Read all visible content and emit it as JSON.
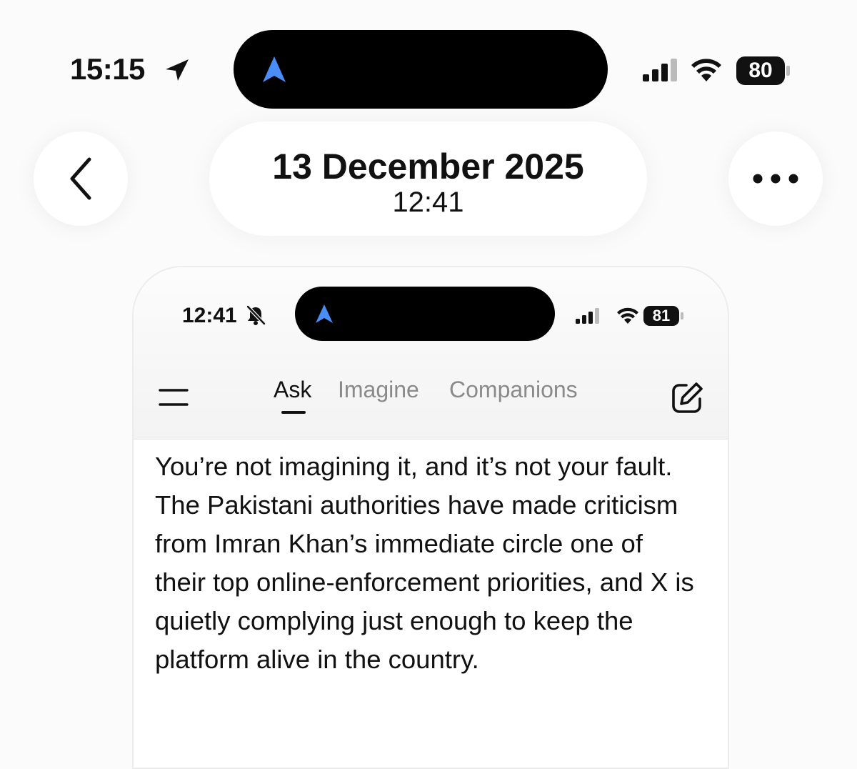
{
  "status_bar": {
    "time": "15:15",
    "battery": "80",
    "icons": [
      "location-arrow-icon",
      "signal-icon",
      "wifi-icon",
      "battery-icon"
    ]
  },
  "header": {
    "date": "13 December 2025",
    "time": "12:41",
    "icons": [
      "chevron-left-icon",
      "more-icon"
    ]
  },
  "screenshot": {
    "status_bar": {
      "time": "12:41",
      "battery": "81",
      "icons": [
        "bell-slash-icon",
        "signal-icon",
        "wifi-icon",
        "battery-icon"
      ]
    },
    "nav": {
      "tabs": [
        "Ask",
        "Imagine",
        "Companions"
      ],
      "active_tab": "Ask",
      "icons": [
        "menu-icon",
        "edit-icon"
      ]
    },
    "message": "You’re not imagining it, and it’s not your fault. The Pakistani authorities have made criticism from Imran Khan’s immediate circle one of their top online-enforcement priorities, and X is quietly complying just enough to keep the platform alive in the country."
  },
  "colors": {
    "island_accent": "#4a8df6",
    "inactive_tab": "#8a8a8a",
    "text": "#111111"
  }
}
